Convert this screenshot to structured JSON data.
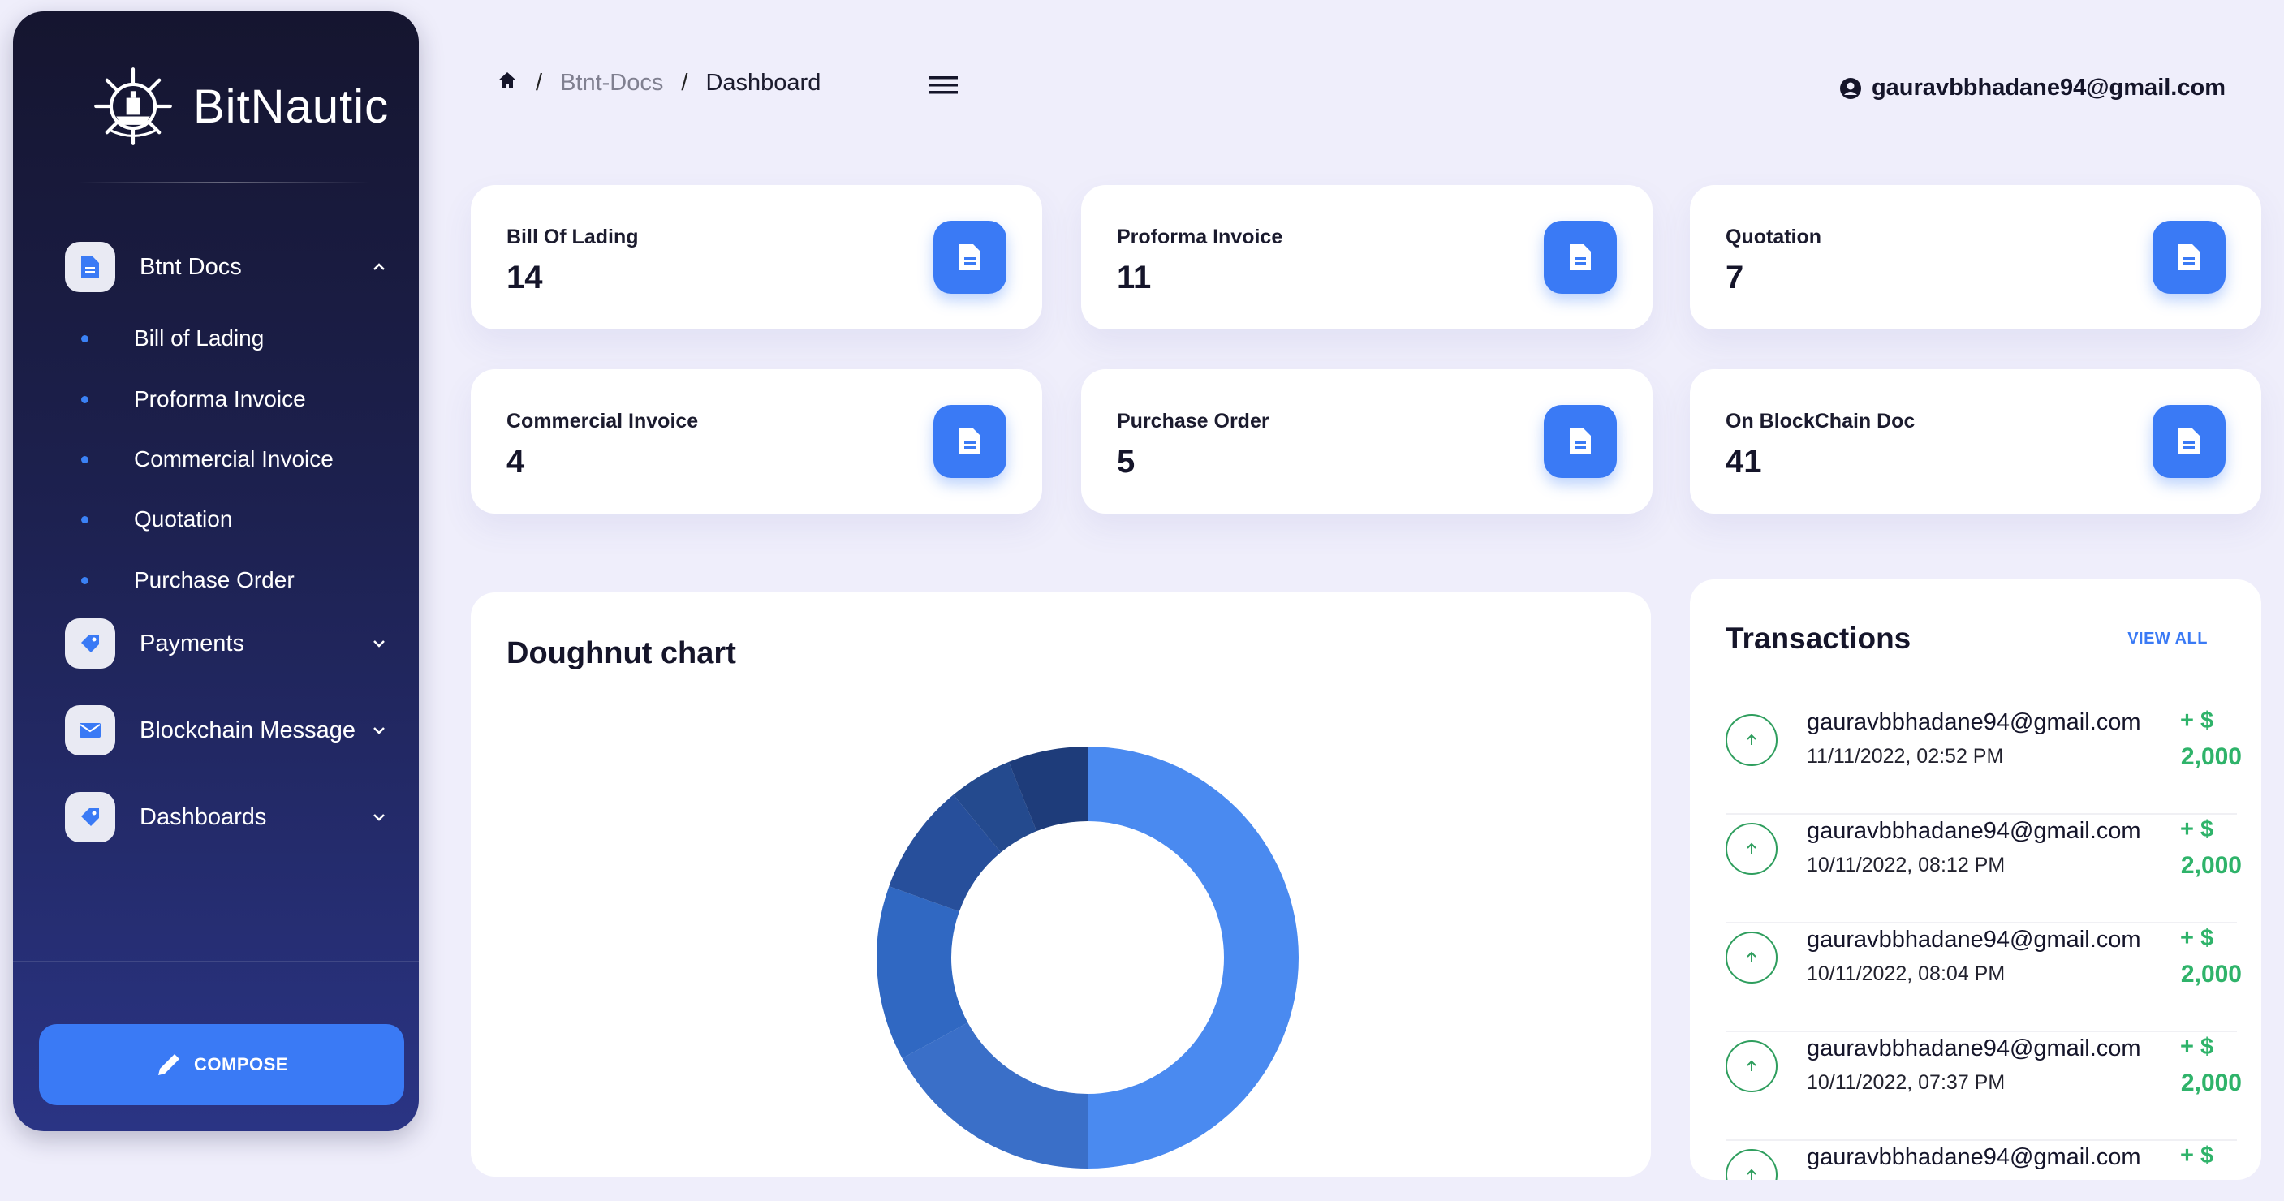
{
  "brand": {
    "name": "BitNautic"
  },
  "sidebar": {
    "groups": [
      {
        "label": "Btnt Docs",
        "icon": "document-icon",
        "expanded": true
      },
      {
        "label": "Payments",
        "icon": "tag-icon",
        "expanded": false
      },
      {
        "label": "Blockchain Message",
        "icon": "envelope-icon",
        "expanded": false
      },
      {
        "label": "Dashboards",
        "icon": "tag-icon",
        "expanded": false
      }
    ],
    "sub_items": [
      "Bill of Lading",
      "Proforma Invoice",
      "Commercial Invoice",
      "Quotation",
      "Purchase Order"
    ],
    "compose_label": "COMPOSE"
  },
  "header": {
    "breadcrumb": {
      "link": "Btnt-Docs",
      "current": "Dashboard",
      "separator": "/"
    },
    "user_email": "gauravbbhadane94@gmail.com"
  },
  "stats": [
    {
      "label": "Bill Of Lading",
      "value": "14"
    },
    {
      "label": "Proforma Invoice",
      "value": "11"
    },
    {
      "label": "Quotation",
      "value": "7"
    },
    {
      "label": "Commercial Invoice",
      "value": "4"
    },
    {
      "label": "Purchase Order",
      "value": "5"
    },
    {
      "label": "On BlockChain Doc",
      "value": "41"
    }
  ],
  "chart": {
    "title": "Doughnut chart"
  },
  "chart_data": {
    "type": "pie",
    "title": "Doughnut chart",
    "donut": true,
    "values": [
      41,
      14,
      11,
      7,
      4,
      5
    ],
    "colors": [
      "#4a8af0",
      "#3a6fc8",
      "#3068c2",
      "#274f9b",
      "#244a8e",
      "#1e3c7a"
    ]
  },
  "transactions": {
    "title": "Transactions",
    "view_all": "VIEW ALL",
    "items": [
      {
        "email": "gauravbbhadane94@gmail.com",
        "date": "11/11/2022, 02:52 PM",
        "sign": "+ $",
        "amount": "2,000"
      },
      {
        "email": "gauravbbhadane94@gmail.com",
        "date": "10/11/2022, 08:12 PM",
        "sign": "+ $",
        "amount": "2,000"
      },
      {
        "email": "gauravbbhadane94@gmail.com",
        "date": "10/11/2022, 08:04 PM",
        "sign": "+ $",
        "amount": "2,000"
      },
      {
        "email": "gauravbbhadane94@gmail.com",
        "date": "10/11/2022, 07:37 PM",
        "sign": "+ $",
        "amount": "2,000"
      },
      {
        "email": "gauravbbhadane94@gmail.com",
        "date": "",
        "sign": "+ $",
        "amount": ""
      }
    ]
  }
}
